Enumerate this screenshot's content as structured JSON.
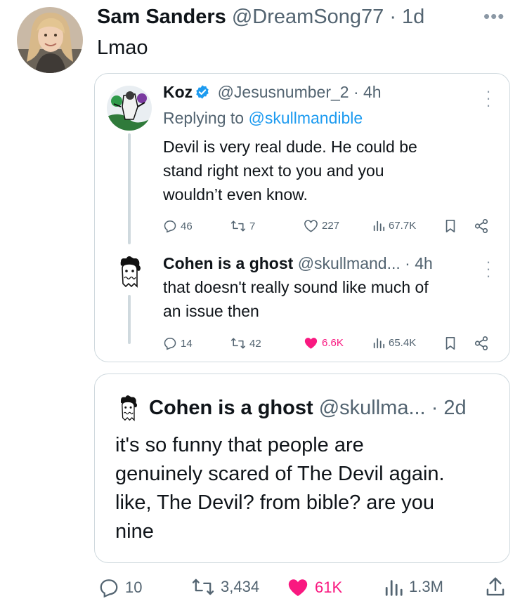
{
  "main_tweet": {
    "display_name": "Sam Sanders",
    "handle": "@DreamSong77",
    "time": "· 1d",
    "text": "Lmao",
    "more_icon": "more-horizontal-icon"
  },
  "thread": [
    {
      "display_name": "Koz",
      "verified": true,
      "handle": "@Jesusnumber_2",
      "time": "· 4h",
      "replying_prefix": "Replying to",
      "replying_to": "@skullmandible",
      "text_lines": [
        "Devil is very real dude. He could be",
        "stand right next to you and you",
        "wouldn’t even know."
      ],
      "stats": {
        "replies": "46",
        "retweets": "7",
        "likes": "227",
        "views": "67.7K"
      }
    },
    {
      "display_name": "Cohen is a ghost",
      "handle": "@skullmand...",
      "time": "· 4h",
      "text_lines": [
        "that doesn't really sound like much of",
        "an issue then"
      ],
      "stats": {
        "replies": "14",
        "retweets": "42",
        "likes": "6.6K",
        "views": "65.4K"
      },
      "liked": true
    }
  ],
  "quote": {
    "display_name": "Cohen is a ghost",
    "handle": "@skullma...",
    "time": "· 2d",
    "text_lines": [
      "it's so funny that people are",
      "genuinely scared of The Devil again.",
      "like, The Devil? from bible? are you",
      "nine"
    ]
  },
  "action_bar": {
    "replies": "10",
    "retweets": "3,434",
    "likes": "61K",
    "views": "1.3M"
  },
  "colors": {
    "text": "#0f1419",
    "secondary": "#536471",
    "link": "#1d9bf0",
    "like": "#f91880",
    "border": "#cfd9de"
  }
}
